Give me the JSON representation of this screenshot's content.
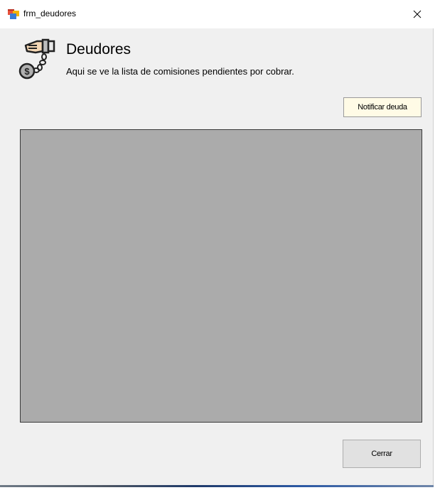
{
  "window": {
    "title": "frm_deudores",
    "close_glyph": "✕"
  },
  "header": {
    "icon": "debtor-chain-money-icon",
    "title": "Deudores",
    "subtitle": "Aqui se ve la lista de comisiones pendientes por cobrar."
  },
  "toolbar": {
    "notify_label": "Notificar deuda"
  },
  "grid": {
    "rows": []
  },
  "footer": {
    "close_label": "Cerrar"
  },
  "colors": {
    "window_bg": "#f0f0f0",
    "grid_bg": "#ababab",
    "notify_bg": "#fffbe6"
  }
}
